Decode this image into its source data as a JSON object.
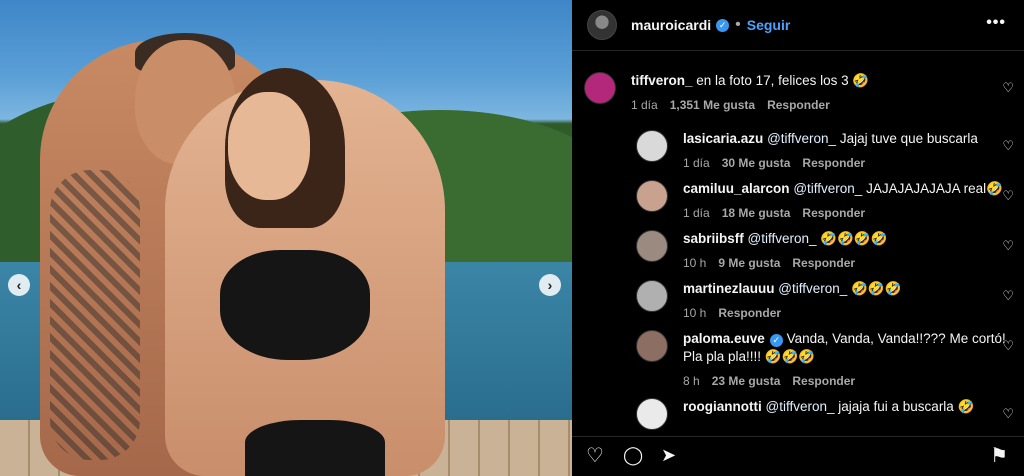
{
  "post": {
    "username": "mauroicardi",
    "verified": true,
    "separator": "•",
    "follow_label": "Seguir",
    "more_label": "•••",
    "carousel_prev": "‹",
    "carousel_next": "›"
  },
  "icons": {
    "heart": "♡",
    "comment": "◯",
    "share": "➤",
    "bookmark": "⚑"
  },
  "comments": [
    {
      "user": "tiffveron_",
      "mention": "",
      "text": "en la foto 17, felices los 3 🤣",
      "time": "1 día",
      "likes": "1,351 Me gusta",
      "reply": "Responder",
      "avatar_color": "#b3287a"
    },
    {
      "user": "lasicaria.azu",
      "mention": "@tiffveron_",
      "text": "Jajaj tuve que buscarla",
      "time": "1 día",
      "likes": "30 Me gusta",
      "reply": "Responder",
      "avatar_color": "#d9d9d9"
    },
    {
      "user": "camiluu_alarcon",
      "mention": "@tiffveron_",
      "text": "JAJAJAJAJAJA real🤣",
      "time": "1 día",
      "likes": "18 Me gusta",
      "reply": "Responder",
      "avatar_color": "#c9a28f"
    },
    {
      "user": "sabriibsff",
      "mention": "@tiffveron_",
      "text": "🤣🤣🤣🤣",
      "time": "10 h",
      "likes": "9 Me gusta",
      "reply": "Responder",
      "avatar_color": "#9a8a80"
    },
    {
      "user": "martinezlauuu",
      "mention": "@tiffveron_",
      "text": "🤣🤣🤣",
      "time": "10 h",
      "likes": "",
      "reply": "Responder",
      "avatar_color": "#b0b0b0"
    },
    {
      "user": "paloma.euve",
      "mention": "",
      "text": "Vanda, Vanda, Vanda!!??? Me cortó! Pla pla pla!!!! 🤣🤣🤣",
      "time": "8 h",
      "likes": "23 Me gusta",
      "reply": "Responder",
      "avatar_color": "#8c6e63",
      "verified": true
    },
    {
      "user": "roogiannotti",
      "mention": "@tiffveron_",
      "text": "jajaja fui a buscarla 🤣",
      "time": "",
      "likes": "",
      "reply": "",
      "avatar_color": "#eaeaea"
    }
  ]
}
